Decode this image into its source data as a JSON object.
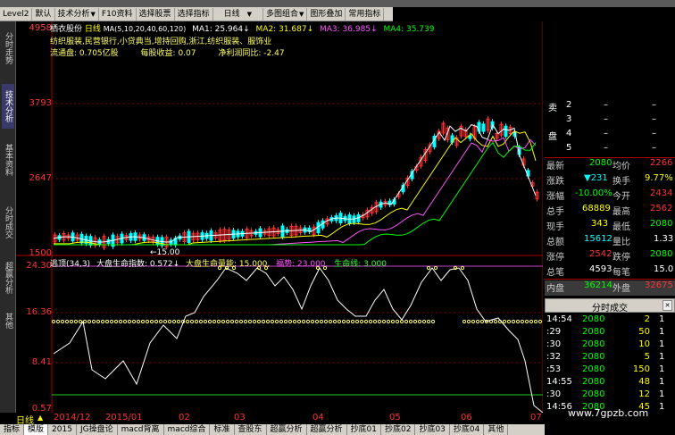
{
  "menubar": {
    "level2": "Level2",
    "default": "默认",
    "tech": "技术分析",
    "f10": "F10资料",
    "pick_stock": "选择股票",
    "pick_index": "选择指标",
    "period": "日线",
    "multi": "多图组合",
    "overlay": "图形叠加",
    "common": "常用指标"
  },
  "leftbar": [
    "分时走势",
    "技术分析",
    "基本资料",
    "分时成交",
    "超赢分析",
    "其他"
  ],
  "chart": {
    "price_high": "4958",
    "price_3793": "3793",
    "price_2647": "2647",
    "price_1500": "1500",
    "ind_24": "24.30",
    "ind_16": "16.36",
    "ind_8": "8.41",
    "ind_0": "0.57",
    "stock_name": "栖衣股份",
    "period": "日线",
    "ma_label": "MA(5,10,20,40,60,120)",
    "ma1": "MA1: 25.964↓",
    "ma2": "MA2: 31.687↓",
    "ma3": "MA3: 36.985↓",
    "ma4": "MA4: 35.739",
    "info1": "纺织服装,民营银行,小贷典当,增持回购,浙江,纺织服装、服饰业",
    "float_label": "流通盘: 0.705亿股",
    "eps_label": "每股收益: 0.07",
    "growth_label": "净利润同比: -2.47",
    "low_marker": "15.00",
    "ind_title": "逃顶(34,3)",
    "ind_life": "大盘生命指数: 0.572↓",
    "ind_energy": "大盘生命量能: 15.000,",
    "ind_escape": "福势: 23.000,",
    "ind_line": "生命线: 3.000"
  },
  "orderbook": {
    "sell_label": "卖",
    "buy_label": "盘",
    "levels": [
      {
        "n": "2",
        "p": "–",
        "v": "–"
      },
      {
        "n": "3",
        "p": "–",
        "v": "–"
      },
      {
        "n": "4",
        "p": "–",
        "v": "–"
      },
      {
        "n": "5",
        "p": "–",
        "v": "–"
      }
    ]
  },
  "quote": {
    "latest_l": "最新",
    "latest": "2080",
    "avg_l": "均价",
    "avg": "2266",
    "change_l": "涨跌",
    "change": "▼231",
    "turnover_l": "换手",
    "turnover": "9.77%",
    "pct_l": "涨幅",
    "pct": "-10.00%",
    "open_l": "今开",
    "open": "2434",
    "total_l": "总手",
    "total": "68889",
    "high_l": "最高",
    "high": "2562",
    "cur_l": "现手",
    "cur": "343",
    "low_l": "最低",
    "low": "2080",
    "amt_l": "总额",
    "amt": "15612",
    "ratio_l": "量比",
    "ratio": "1.33",
    "limitup_l": "涨停",
    "limitup": "2542",
    "limitdown_l": "跌停",
    "limitdown": "2080",
    "deals_l": "总笔",
    "deals": "4593",
    "per_l": "每笔",
    "per": "15.0",
    "inner_l": "内盘",
    "inner": "36214",
    "outer_l": "外盘",
    "outer": "32675"
  },
  "ticks": {
    "title": "分时成交",
    "rows": [
      {
        "t": "14:54",
        "p": "2080",
        "v": "2",
        "d": "1"
      },
      {
        "t": ":29",
        "p": "2080",
        "v": "50",
        "d": "1"
      },
      {
        "t": ":30",
        "p": "2080",
        "v": "10",
        "d": "1"
      },
      {
        "t": ":32",
        "p": "2080",
        "v": "5",
        "d": "1"
      },
      {
        "t": ":53",
        "p": "2080",
        "v": "150",
        "d": "1"
      },
      {
        "t": "14:55",
        "p": "2080",
        "v": "48",
        "d": "1"
      },
      {
        "t": ":30",
        "p": "2080",
        "v": "12",
        "d": "1"
      },
      {
        "t": "14:56",
        "p": "2080",
        "v": "45",
        "d": "1"
      }
    ]
  },
  "dateaxis": {
    "period": "日线",
    "d1": "2014/12",
    "d2": "2015/01",
    "d3": "02",
    "d4": "03",
    "d5": "04",
    "d6": "05",
    "d7": "06",
    "d8": "07"
  },
  "tabs": [
    "指标",
    "模版",
    "2015",
    "JG操盘论",
    "macd背离",
    "macd综合",
    "标准",
    "查股东",
    "超赢分析",
    "超赢分析",
    "抄底01",
    "抄底02",
    "抄底03",
    "抄底04",
    "其他"
  ],
  "watermark": "www.7gpzb.com",
  "colors": {
    "up": "#ff3333",
    "down": "#00ffff",
    "ma1": "#ffffff",
    "ma2": "#ffff00",
    "ma3": "#ff55ff",
    "ma4": "#00ff00"
  }
}
